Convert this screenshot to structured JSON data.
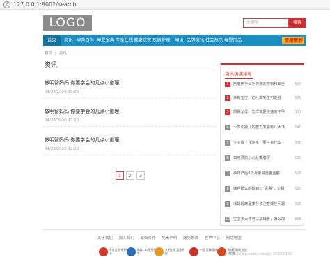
{
  "browser": {
    "url": "127.0.0.1:8002/search"
  },
  "header": {
    "logo": "LOGO",
    "search_placeholder": "关键字",
    "search_button": "搜索"
  },
  "nav": {
    "items": [
      "首页",
      "资讯",
      "孕育百科",
      "母婴宝典",
      "专家在线",
      "健康饮食",
      "疾病护理",
      "知识",
      "品牌资讯",
      "社会热点",
      "母婴用品"
    ],
    "tag": "专题策划"
  },
  "breadcrumb": {
    "home": "首页",
    "sep": "|",
    "current": "资讯"
  },
  "page_title": "资讯",
  "articles": [
    {
      "title": "做明智妈妈 你要学会的几点小道理",
      "date": "04/28/2020 12:20"
    },
    {
      "title": "做明智妈妈 你要学会的几点小道理",
      "date": "04/28/2020 12:20"
    },
    {
      "title": "做明智妈妈 你要学会的几点小道理",
      "date": "04/28/2020 12:20"
    }
  ],
  "pagination": {
    "pages": [
      "1",
      "2",
      "3"
    ],
    "current": "1"
  },
  "rank": {
    "title": "资讯热读排名",
    "items": [
      {
        "n": "1",
        "title": "剖腹怀孕么补的看的学到和安全",
        "count": "394"
      },
      {
        "n": "2",
        "title": "家有宝宝，幼儿期吃生可能低",
        "count": "370"
      },
      {
        "n": "3",
        "title": "想做父母，怎样做更快速的怀孕",
        "count": "355"
      },
      {
        "n": "4",
        "title": "一岁内婴儿的智力发展有八大飞",
        "count": "340"
      },
      {
        "n": "5",
        "title": "宝宝喝了花茶水，要注意什么",
        "count": "336"
      },
      {
        "n": "6",
        "title": "如何预防小儿秋季腹泻",
        "count": "330"
      },
      {
        "n": "7",
        "title": "孕妇产后6个月要减重量金额",
        "count": "328"
      },
      {
        "n": "8",
        "title": "嫌弃那么的碰到过\"尿裹\"，少碰",
        "count": "320"
      },
      {
        "n": "9",
        "title": "准妈妈高温季节该注意哪些问题",
        "count": "318"
      },
      {
        "n": "10",
        "title": "宝宝多大才可以加辅食，怎么加",
        "count": "316"
      }
    ]
  },
  "footer": {
    "links": [
      "关于我们",
      "加入我们",
      "联络合作",
      "免责声明",
      "服务条款",
      "客户中心",
      "网站地图"
    ],
    "badges": [
      {
        "label": "不良信息 举报中心",
        "color": "#d23a2c"
      },
      {
        "label": "网络110 报警服务",
        "color": "#2f6fb8"
      },
      {
        "label": "文明上网 监督举报",
        "color": "#e29a22"
      },
      {
        "label": "中国 互联网协会",
        "color": "#c9342a"
      },
      {
        "label": "无线互联网 业自律同盟",
        "color": "#d24a1e"
      }
    ]
  },
  "watermark": "https://blog.csdn.net/qq_35353981"
}
